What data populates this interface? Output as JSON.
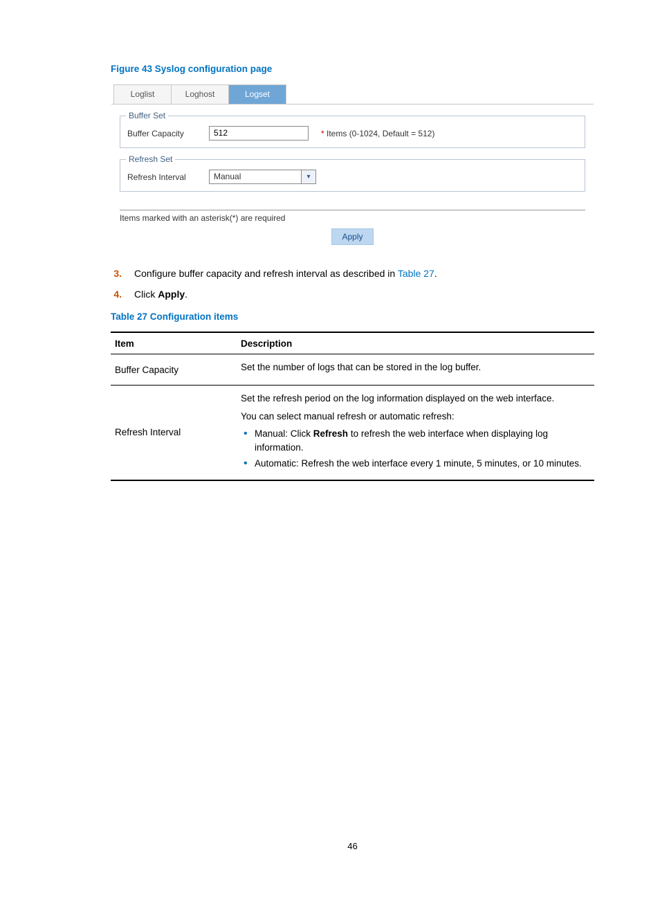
{
  "figure_title": "Figure 43 Syslog configuration page",
  "tabs": {
    "loglist": "Loglist",
    "loghost": "Loghost",
    "logset": "Logset"
  },
  "groups": {
    "buffer_set": {
      "legend": "Buffer Set",
      "capacity_label": "Buffer Capacity",
      "capacity_value": "512",
      "capacity_note": "Items (0-1024, Default = 512)"
    },
    "refresh_set": {
      "legend": "Refresh Set",
      "interval_label": "Refresh Interval",
      "interval_value": "Manual"
    }
  },
  "required_note": "Items marked with an asterisk(*) are required",
  "apply_label": "Apply",
  "steps": {
    "s3": {
      "num": "3.",
      "pre": "Configure buffer capacity and refresh interval as described in ",
      "link": "Table 27",
      "post": "."
    },
    "s4": {
      "num": "4.",
      "pre": "Click ",
      "bold": "Apply",
      "post": "."
    }
  },
  "table_title": "Table 27 Configuration items",
  "table": {
    "headers": {
      "item": "Item",
      "desc": "Description"
    },
    "rows": {
      "r1": {
        "item": "Buffer Capacity",
        "desc": "Set the number of logs that can be stored in the log buffer."
      },
      "r2": {
        "item": "Refresh Interval",
        "p1": "Set the refresh period on the log information displayed on the web interface.",
        "p2": "You can select manual refresh or automatic refresh:",
        "b1_pre": "Manual: Click ",
        "b1_bold": "Refresh",
        "b1_post": " to refresh the web interface when displaying log information.",
        "b2": "Automatic: Refresh the web interface every 1 minute, 5 minutes, or 10 minutes."
      }
    }
  },
  "page_number": "46"
}
